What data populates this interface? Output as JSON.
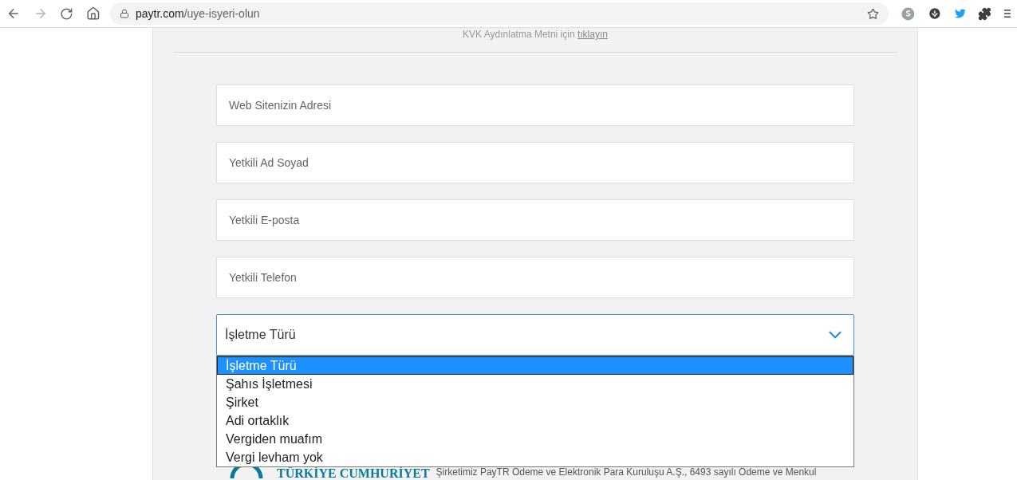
{
  "browser": {
    "url_host": "paytr.com",
    "url_path": "/uye-isyeri-olun"
  },
  "notice": {
    "text": "KVK Aydınlatma Metni için",
    "link": "tıklayın"
  },
  "fields": [
    {
      "placeholder": "Web Sitenizin Adresi"
    },
    {
      "placeholder": "Yetkili Ad Soyad"
    },
    {
      "placeholder": "Yetkili E-posta"
    },
    {
      "placeholder": "Yetkili Telefon"
    }
  ],
  "select": {
    "value": "İşletme Türü",
    "expanded": true,
    "options": [
      {
        "label": "İşletme Türü",
        "selected": true
      },
      {
        "label": "Şahıs İşletmesi",
        "selected": false
      },
      {
        "label": "Şirket",
        "selected": false
      },
      {
        "label": "Adi ortaklık",
        "selected": false
      },
      {
        "label": "Vergiden muafım",
        "selected": false
      },
      {
        "label": "Vergi levham yok",
        "selected": false
      }
    ]
  },
  "footer": {
    "logo_text": "TÜRKİYE CUMHURİYET",
    "text": "Şirketimiz PayTR Ödeme ve Elektronik Para Kuruluşu A.Ş., 6493 sayılı Ödeme ve Menkul"
  }
}
